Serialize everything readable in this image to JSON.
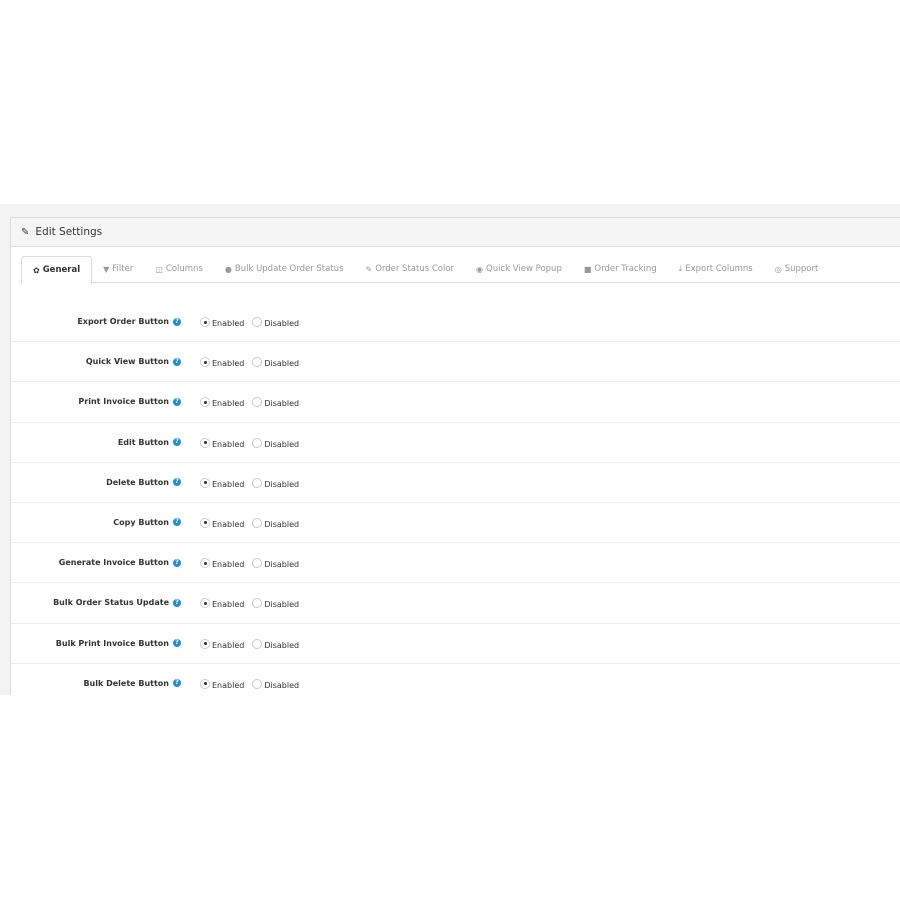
{
  "panel": {
    "title": "Edit Settings",
    "icon": "pencil-icon"
  },
  "tabs": [
    {
      "label": "General",
      "icon": "gear-icon",
      "glyph": "✿",
      "active": true
    },
    {
      "label": "Filter",
      "icon": "filter-icon",
      "glyph": "▼"
    },
    {
      "label": "Columns",
      "icon": "columns-icon",
      "glyph": "◫"
    },
    {
      "label": "Bulk Update Order Status",
      "icon": "comment-icon",
      "glyph": "●"
    },
    {
      "label": "Order Status Color",
      "icon": "brush-icon",
      "glyph": "✎"
    },
    {
      "label": "Quick View Popup",
      "icon": "eye-icon",
      "glyph": "◉"
    },
    {
      "label": "Order Tracking",
      "icon": "truck-icon",
      "glyph": "■"
    },
    {
      "label": "Export Columns",
      "icon": "download-icon",
      "glyph": "⤓"
    },
    {
      "label": "Support",
      "icon": "life-ring-icon",
      "glyph": "◎"
    }
  ],
  "options": {
    "enabled": "Enabled",
    "disabled": "Disabled"
  },
  "settings": [
    {
      "label": "Export Order Button",
      "value": "Enabled"
    },
    {
      "label": "Quick View Button",
      "value": "Enabled"
    },
    {
      "label": "Print Invoice Button",
      "value": "Enabled"
    },
    {
      "label": "Edit Button",
      "value": "Enabled"
    },
    {
      "label": "Delete Button",
      "value": "Enabled"
    },
    {
      "label": "Copy Button",
      "value": "Enabled"
    },
    {
      "label": "Generate Invoice Button",
      "value": "Enabled"
    },
    {
      "label": "Bulk Order Status Update",
      "value": "Enabled"
    },
    {
      "label": "Bulk Print Invoice Button",
      "value": "Enabled"
    },
    {
      "label": "Bulk Delete Button",
      "value": "Enabled"
    }
  ],
  "colors": {
    "help": "#1e8fd6"
  }
}
